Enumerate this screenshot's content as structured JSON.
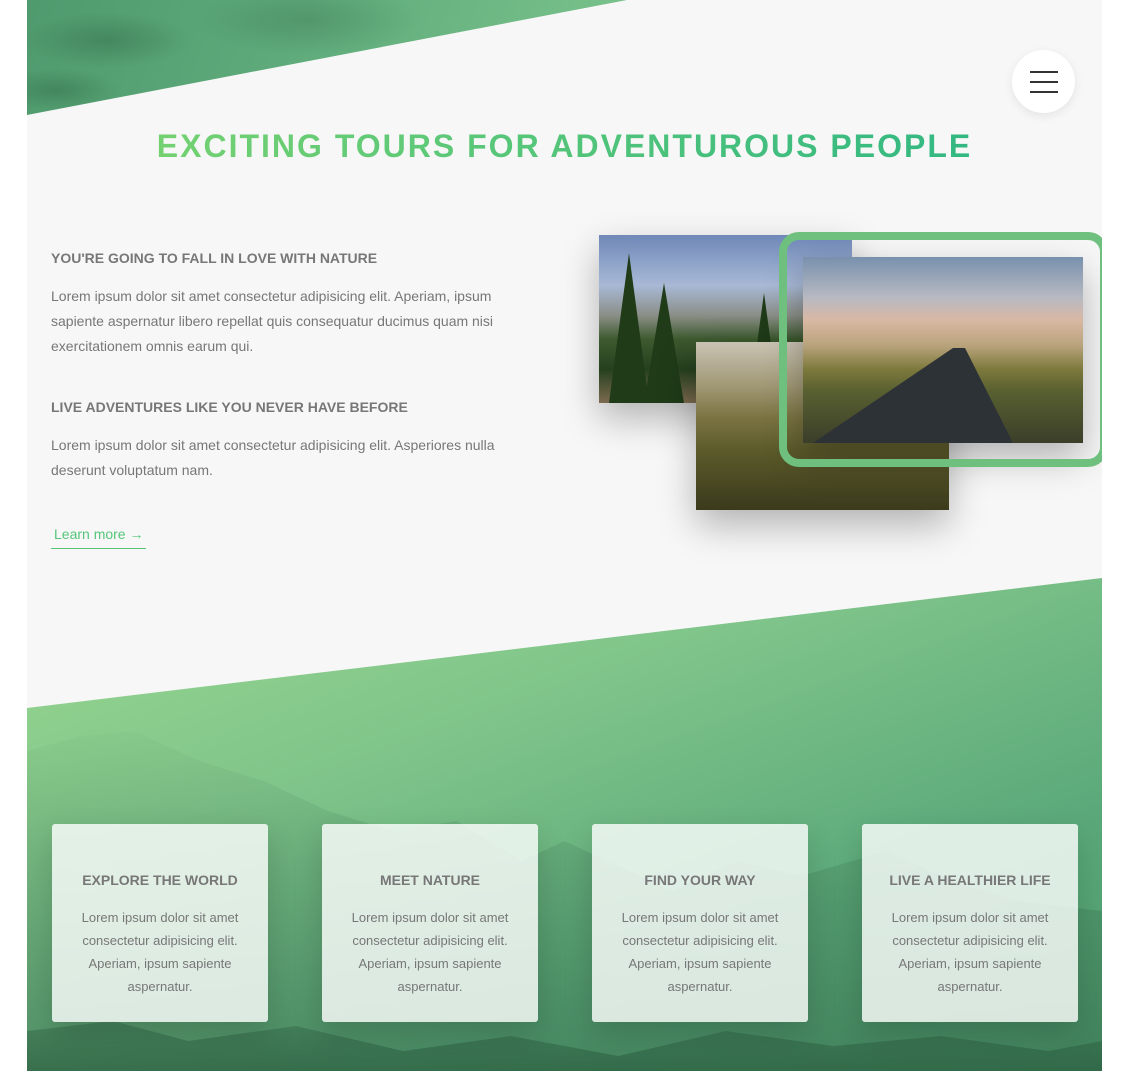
{
  "header": {
    "title": "EXCITING TOURS FOR ADVENTUROUS PEOPLE"
  },
  "about": {
    "sections": [
      {
        "heading": "YOU'RE GOING TO FALL IN LOVE WITH NATURE",
        "text": "Lorem ipsum dolor sit amet consectetur adipisicing elit. Aperiam, ipsum sapiente aspernatur libero repellat quis consequatur ducimus quam nisi exercitationem omnis earum qui."
      },
      {
        "heading": "LIVE ADVENTURES LIKE YOU NEVER HAVE BEFORE",
        "text": "Lorem ipsum dolor sit amet consectetur adipisicing elit. Asperiores nulla deserunt voluptatum nam."
      }
    ],
    "link_label": "Learn more →"
  },
  "features": [
    {
      "title": "EXPLORE THE WORLD",
      "text": "Lorem ipsum dolor sit amet consectetur adipisicing elit. Aperiam, ipsum sapiente aspernatur."
    },
    {
      "title": "MEET NATURE",
      "text": "Lorem ipsum dolor sit amet consectetur adipisicing elit. Aperiam, ipsum sapiente aspernatur."
    },
    {
      "title": "FIND YOUR WAY",
      "text": "Lorem ipsum dolor sit amet consectetur adipisicing elit. Aperiam, ipsum sapiente aspernatur."
    },
    {
      "title": "LIVE A HEALTHIER LIFE",
      "text": "Lorem ipsum dolor sit amet consectetur adipisicing elit. Aperiam, ipsum sapiente aspernatur."
    }
  ],
  "icons": {
    "menu": "hamburger-menu-icon"
  },
  "colors": {
    "accent_light": "#7ed56f",
    "accent_dark": "#28b485",
    "frame": "#6fc07e",
    "text": "#777777",
    "background": "#f7f7f7"
  }
}
